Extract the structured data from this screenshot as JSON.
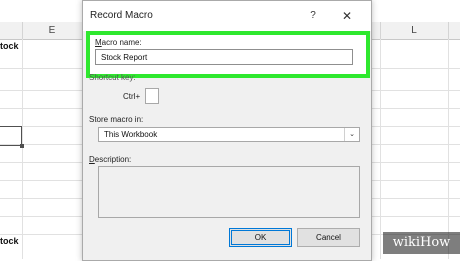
{
  "spreadsheet": {
    "column_headers": [
      {
        "label": ""
      },
      {
        "label": "E"
      },
      {
        "label": ""
      },
      {
        "label": ""
      },
      {
        "label": ""
      },
      {
        "label": ""
      },
      {
        "label": "L"
      },
      {
        "label": ""
      }
    ],
    "cell_top": "tock",
    "cell_bottom": "tock"
  },
  "dialog": {
    "title": "Record Macro",
    "help_glyph": "?",
    "close_glyph": "✕",
    "macro_name_label": "Macro name:",
    "macro_name_value": "Stock Report",
    "shortcut_label": "Shortcut key:",
    "ctrl_label": "Ctrl+",
    "shortcut_value": "",
    "store_label": "Store macro in:",
    "store_value": "This Workbook",
    "store_arrow": "⌄",
    "description_label": "Description:",
    "description_value": "",
    "ok_label": "OK",
    "cancel_label": "Cancel",
    "highlight_color": "#2ee82e",
    "accent_color": "#0078d7"
  },
  "watermark": {
    "text": "wikiHow"
  }
}
